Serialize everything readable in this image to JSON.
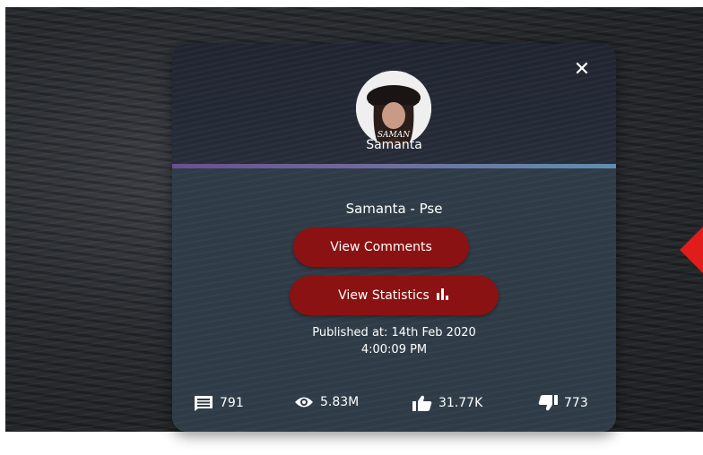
{
  "card": {
    "channel_name": "Samanta",
    "avatar_text": "SAMAN",
    "video_title": "Samanta - Pse",
    "buttons": {
      "view_comments": "View Comments",
      "view_statistics": "View Statistics"
    },
    "published_line1": "Published at: 14th Feb 2020",
    "published_line2": "4:00:09 PM",
    "stats": {
      "comments": "791",
      "views": "5.83M",
      "likes": "31.77K",
      "dislikes": "773"
    }
  },
  "icons": [
    "close-icon",
    "bar-chart-icon",
    "comment-icon",
    "eye-icon",
    "thumbs-up-icon",
    "thumbs-down-icon"
  ],
  "colors": {
    "button": "#8b1212",
    "card_body": "#2f3c47",
    "accent_start": "#6a4f8f",
    "accent_end": "#5f8fb0",
    "arrow": "#e21b1b"
  }
}
